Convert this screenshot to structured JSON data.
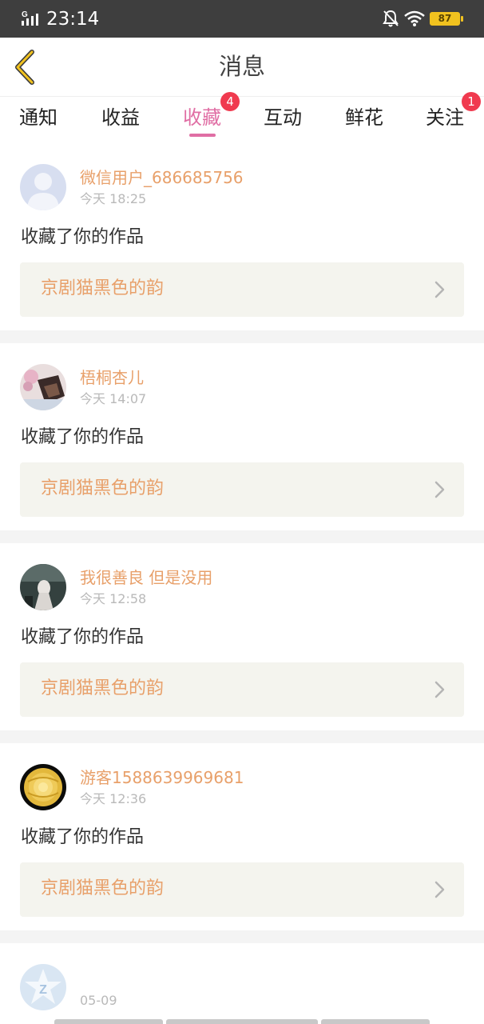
{
  "status_bar": {
    "signal_label": "G",
    "time": "23:14",
    "battery": "87",
    "colors": {
      "background": "#3e3e3e",
      "battery": "#f1c21f"
    },
    "icons": [
      "signal-icon",
      "bell-off-icon",
      "wifi-icon",
      "battery-icon"
    ]
  },
  "header": {
    "title": "消息",
    "back_icon": "chevron-left-icon"
  },
  "tabs": [
    {
      "label": "通知"
    },
    {
      "label": "收益"
    },
    {
      "label": "收藏",
      "active": true,
      "badge": "4"
    },
    {
      "label": "互动"
    },
    {
      "label": "鲜花"
    },
    {
      "label": "关注",
      "badge": "1"
    }
  ],
  "theme": {
    "accent": "#e06ea4",
    "username_color": "#e8a06a",
    "badge_color": "#f03a4f",
    "work_card_bg": "#f4f4ee"
  },
  "messages": [
    {
      "username": "微信用户_686685756",
      "time": "今天 18:25",
      "action": "收藏了你的作品",
      "work_title": "京剧猫黑色的韵",
      "avatar": "default-user-avatar"
    },
    {
      "username": "梧桐杏儿",
      "time": "今天 14:07",
      "action": "收藏了你的作品",
      "work_title": "京剧猫黑色的韵",
      "avatar": "photo-avatar"
    },
    {
      "username": "我很善良 但是没用",
      "time": "今天 12:58",
      "action": "收藏了你的作品",
      "work_title": "京剧猫黑色的韵",
      "avatar": "photo-avatar"
    },
    {
      "username": "游客1588639969681",
      "time": "今天 12:36",
      "action": "收藏了你的作品",
      "work_title": "京剧猫黑色的韵",
      "avatar": "yellow-flower-avatar"
    }
  ],
  "partial_message": {
    "time": "05-09",
    "avatar": "star-z-avatar"
  }
}
